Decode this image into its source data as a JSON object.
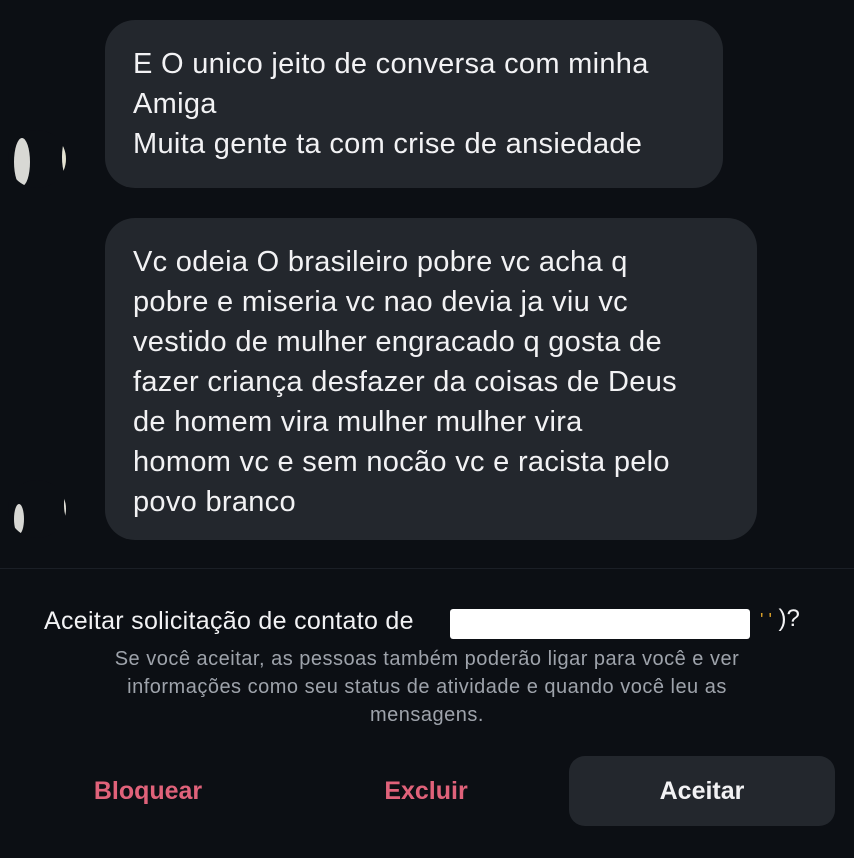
{
  "messages": [
    {
      "lines": [
        "E O unico jeito de conversa com minha",
        "Amiga",
        "Muita gente ta com crise de ansiedade"
      ]
    },
    {
      "lines": [
        "Vc odeia O brasileiro pobre vc acha q",
        "pobre e miseria vc nao devia ja viu vc",
        "vestido de mulher engracado q gosta de",
        "fazer criança desfazer da coisas de Deus",
        "de homem vira mulher mulher vira",
        "homom vc e sem nocão vc e racista pelo",
        "povo branco"
      ]
    }
  ],
  "request": {
    "title": "Aceitar solicitação de contato de",
    "title_end": ")?",
    "description_lines": [
      "Se você aceitar, as pessoas também poderão ligar para você e ver",
      "informações como seu status de atividade e quando você leu as",
      "mensagens."
    ]
  },
  "actions": {
    "block_label": "Bloquear",
    "delete_label": "Excluir",
    "accept_label": "Aceitar"
  },
  "colors": {
    "background": "#0c0f14",
    "bubble": "#23272d",
    "danger": "#e0627a",
    "muted_text": "#9ea3ab"
  }
}
